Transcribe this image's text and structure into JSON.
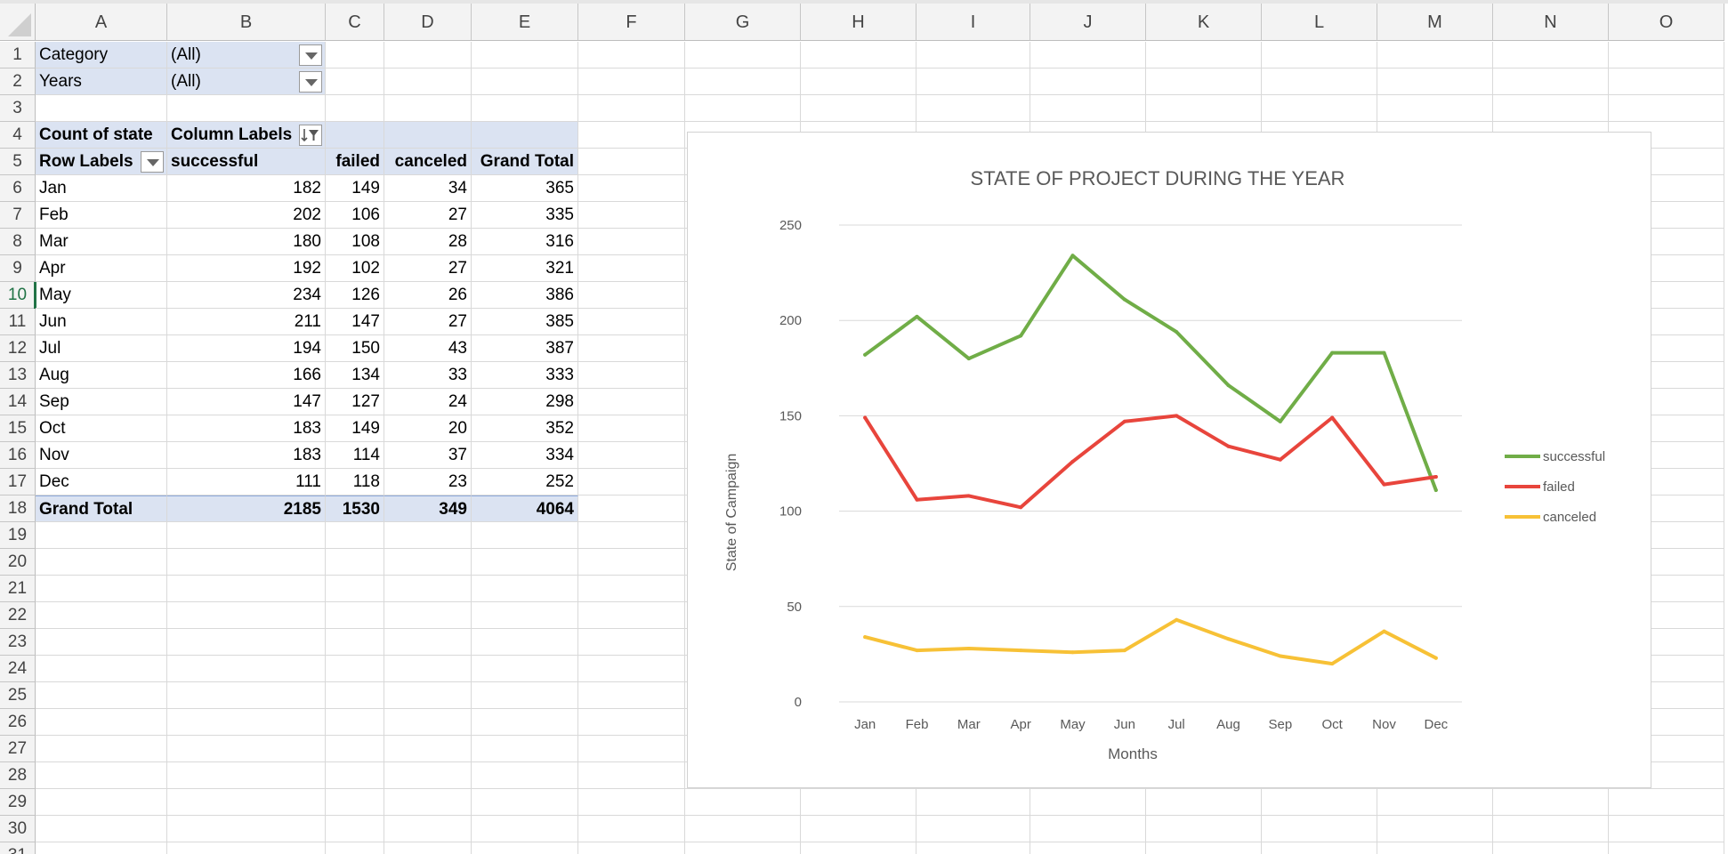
{
  "columns": [
    "A",
    "B",
    "C",
    "D",
    "E",
    "F",
    "G",
    "H",
    "I",
    "J",
    "K",
    "L",
    "M",
    "N",
    "O"
  ],
  "rows": [
    "1",
    "2",
    "3",
    "4",
    "5",
    "6",
    "7",
    "8",
    "9",
    "10",
    "11",
    "12",
    "13",
    "14",
    "15",
    "16",
    "17",
    "18",
    "19",
    "20",
    "21",
    "22",
    "23",
    "24",
    "25",
    "26",
    "27",
    "28",
    "29",
    "30",
    "31"
  ],
  "selected_row": "10",
  "filters": [
    {
      "label": "Category",
      "value": "(All)"
    },
    {
      "label": "Years",
      "value": "(All)"
    }
  ],
  "pivot": {
    "value_label": "Count of state",
    "column_labels": "Column Labels",
    "row_labels": "Row Labels",
    "headers": [
      "successful",
      "failed",
      "canceled",
      "Grand Total"
    ],
    "rows": [
      {
        "label": "Jan",
        "values": [
          "182",
          "149",
          "34",
          "365"
        ]
      },
      {
        "label": "Feb",
        "values": [
          "202",
          "106",
          "27",
          "335"
        ]
      },
      {
        "label": "Mar",
        "values": [
          "180",
          "108",
          "28",
          "316"
        ]
      },
      {
        "label": "Apr",
        "values": [
          "192",
          "102",
          "27",
          "321"
        ]
      },
      {
        "label": "May",
        "values": [
          "234",
          "126",
          "26",
          "386"
        ]
      },
      {
        "label": "Jun",
        "values": [
          "211",
          "147",
          "27",
          "385"
        ]
      },
      {
        "label": "Jul",
        "values": [
          "194",
          "150",
          "43",
          "387"
        ]
      },
      {
        "label": "Aug",
        "values": [
          "166",
          "134",
          "33",
          "333"
        ]
      },
      {
        "label": "Sep",
        "values": [
          "147",
          "127",
          "24",
          "298"
        ]
      },
      {
        "label": "Oct",
        "values": [
          "183",
          "149",
          "20",
          "352"
        ]
      },
      {
        "label": "Nov",
        "values": [
          "183",
          "114",
          "37",
          "334"
        ]
      },
      {
        "label": "Dec",
        "values": [
          "111",
          "118",
          "23",
          "252"
        ]
      }
    ],
    "total_label": "Grand Total",
    "totals": [
      "2185",
      "1530",
      "349",
      "4064"
    ]
  },
  "chart_data": {
    "type": "line",
    "title": "STATE OF PROJECT DURING THE YEAR",
    "xlabel": "Months",
    "ylabel": "State of Campaign",
    "categories": [
      "Jan",
      "Feb",
      "Mar",
      "Apr",
      "May",
      "Jun",
      "Jul",
      "Aug",
      "Sep",
      "Oct",
      "Nov",
      "Dec"
    ],
    "ylim": [
      0,
      250
    ],
    "yticks": [
      0,
      50,
      100,
      150,
      200,
      250
    ],
    "grid": true,
    "legend_position": "right",
    "series": [
      {
        "name": "successful",
        "color": "#70ad47",
        "values": [
          182,
          202,
          180,
          192,
          234,
          211,
          194,
          166,
          147,
          183,
          183,
          111
        ]
      },
      {
        "name": "failed",
        "color": "#e8453c",
        "values": [
          149,
          106,
          108,
          102,
          126,
          147,
          150,
          134,
          127,
          149,
          114,
          118
        ]
      },
      {
        "name": "canceled",
        "color": "#f7c136",
        "values": [
          34,
          27,
          28,
          27,
          26,
          27,
          43,
          33,
          24,
          20,
          37,
          23
        ]
      }
    ]
  },
  "colors": {
    "pivot_shade": "#dbe3f2",
    "selection": "#217346"
  },
  "icons": {
    "filter_dropdown": "chevron-down-icon",
    "column_filter": "sort-filter-icon"
  }
}
